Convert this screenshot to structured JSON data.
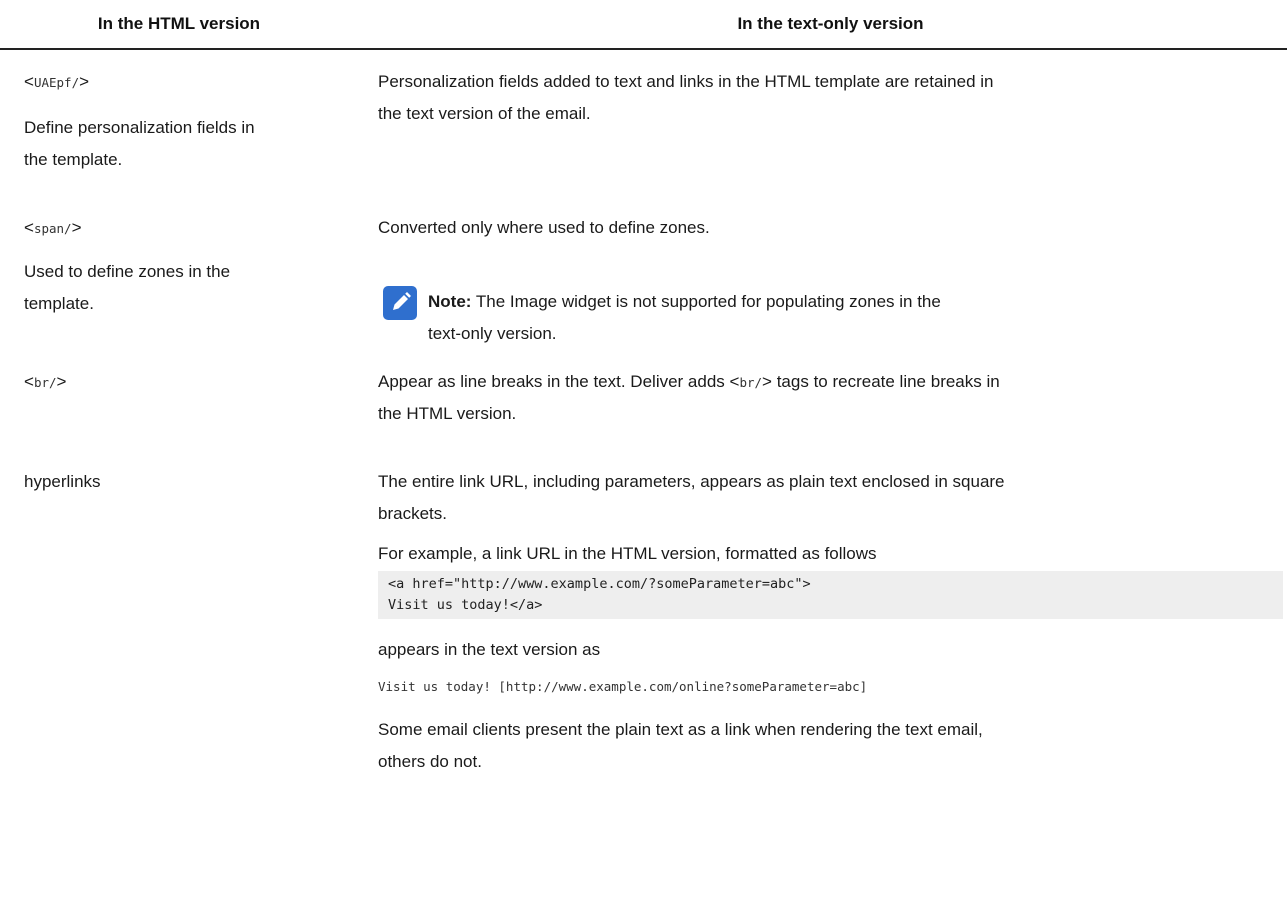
{
  "header": {
    "left": "In the HTML version",
    "right": "In the text-only version"
  },
  "rows": [
    {
      "code": "UAEpf/",
      "left_desc_line1": "Define personalization fields in",
      "left_desc_line2": "the template.",
      "right_line1": "Personalization fields added to text and links in the HTML template are retained in",
      "right_line2": "the text version of the email."
    },
    {
      "code": "span/",
      "left_desc_line1": "Used to define zones in the",
      "left_desc_line2": "template.",
      "right_line1": "Converted only where used to define zones.",
      "note_label": "Note:",
      "note_line1": "The Image widget is not supported for populating zones in the",
      "note_line2": "text-only version."
    },
    {
      "code": "br/",
      "right_line1_pre": "Appear as line breaks in the text. Deliver adds ",
      "right_line1_code": "br/",
      "right_line1_post": " tags to recreate line breaks in",
      "right_line2": "the HTML version."
    },
    {
      "left": "hyperlinks",
      "right_line1": "The entire link URL, including parameters, appears as plain text enclosed in square",
      "right_line2": "brackets.",
      "example_intro": "For example, a link URL in the HTML version, formatted as follows",
      "code_line1": "<a href=\"http://www.example.com/?someParameter=abc\">",
      "code_line2": "Visit us today!</a>",
      "appears": "appears in the text version as",
      "text_example": "Visit us today! [http://www.example.com/online?someParameter=abc]",
      "closing_line1": "Some email clients present the plain text as a link when rendering the text email,",
      "closing_line2": "others do not."
    }
  ],
  "icons": {
    "note": "pencil-icon",
    "note_color": "#2f6fce"
  }
}
